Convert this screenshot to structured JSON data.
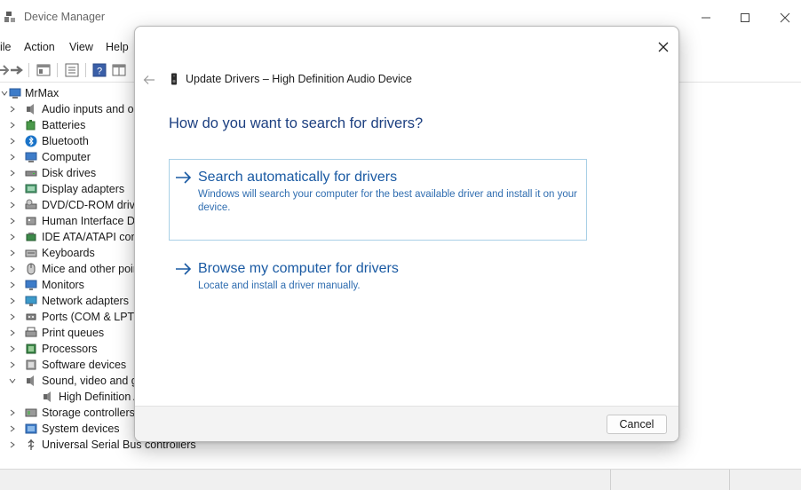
{
  "window": {
    "title": "Device Manager",
    "controls": [
      "minimize-icon",
      "maximize-icon",
      "close-icon"
    ]
  },
  "menu": [
    "ile",
    "Action",
    "View",
    "Help"
  ],
  "tree": {
    "root": "MrMax",
    "items": [
      {
        "label": "Audio inputs and ou",
        "icon": "speaker-mic-icon",
        "expanded": false
      },
      {
        "label": "Batteries",
        "icon": "battery-icon",
        "expanded": false
      },
      {
        "label": "Bluetooth",
        "icon": "bluetooth-icon",
        "expanded": false
      },
      {
        "label": "Computer",
        "icon": "computer-icon",
        "expanded": false
      },
      {
        "label": "Disk drives",
        "icon": "disk-drive-icon",
        "expanded": false
      },
      {
        "label": "Display adapters",
        "icon": "display-adapter-icon",
        "expanded": false
      },
      {
        "label": "DVD/CD-ROM drive",
        "icon": "dvd-drive-icon",
        "expanded": false
      },
      {
        "label": "Human Interface De",
        "icon": "hid-icon",
        "expanded": false
      },
      {
        "label": "IDE ATA/ATAPI contr",
        "icon": "ide-controller-icon",
        "expanded": false
      },
      {
        "label": "Keyboards",
        "icon": "keyboard-icon",
        "expanded": false
      },
      {
        "label": "Mice and other poir",
        "icon": "mouse-icon",
        "expanded": false
      },
      {
        "label": "Monitors",
        "icon": "monitor-icon",
        "expanded": false
      },
      {
        "label": "Network adapters",
        "icon": "network-adapter-icon",
        "expanded": false
      },
      {
        "label": "Ports (COM & LPT)",
        "icon": "port-icon",
        "expanded": false
      },
      {
        "label": "Print queues",
        "icon": "printer-icon",
        "expanded": false
      },
      {
        "label": "Processors",
        "icon": "processor-icon",
        "expanded": false
      },
      {
        "label": "Software devices",
        "icon": "software-device-icon",
        "expanded": false
      },
      {
        "label": "Sound, video and ga",
        "icon": "speaker-icon",
        "expanded": true
      },
      {
        "label": "High Definition A",
        "icon": "speaker-icon",
        "child": true
      },
      {
        "label": "Storage controllers",
        "icon": "storage-controller-icon",
        "expanded": false
      },
      {
        "label": "System devices",
        "icon": "system-device-icon",
        "expanded": false
      },
      {
        "label": "Universal Serial Bus controllers",
        "icon": "usb-icon",
        "expanded": false
      }
    ]
  },
  "dialog": {
    "title": "Update Drivers – High Definition Audio Device",
    "heading": "How do you want to search for drivers?",
    "options": [
      {
        "title": "Search automatically for drivers",
        "description": "Windows will search your computer for the best available driver and install it on your device."
      },
      {
        "title": "Browse my computer for drivers",
        "description": "Locate and install a driver manually."
      }
    ],
    "cancel_label": "Cancel"
  },
  "colors": {
    "heading": "#1c3f80",
    "link": "#1a5aa3",
    "card_border": "#a9d0e6",
    "footer_bg": "#f3f3f3"
  }
}
